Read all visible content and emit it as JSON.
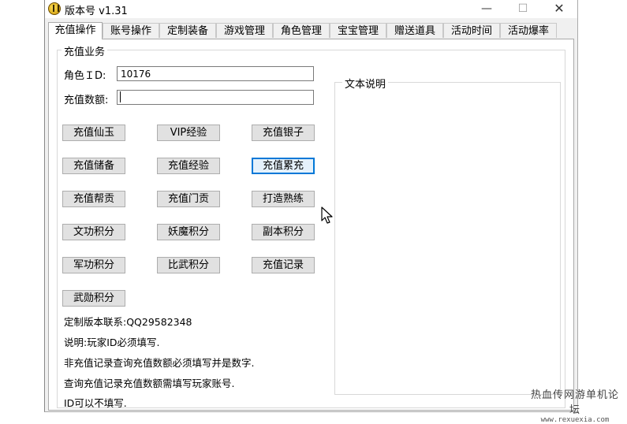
{
  "window": {
    "title": "版本号 v1.31",
    "minimize": "—",
    "maximize": "☐",
    "close": "✕"
  },
  "tabs": [
    "充值操作",
    "账号操作",
    "定制装备",
    "游戏管理",
    "角色管理",
    "宝宝管理",
    "赠送道具",
    "活动时间",
    "活动爆率"
  ],
  "group_title": "充值业务",
  "form": {
    "role_id_label": "角色ＩD:",
    "role_id_value": "10176",
    "amount_label": "充值数额:",
    "amount_value": ""
  },
  "buttons": [
    [
      "充值仙玉",
      "VIP经验",
      "充值银子"
    ],
    [
      "充值储备",
      "充值经验",
      "充值累充"
    ],
    [
      "充值帮贡",
      "充值门贡",
      "打造熟练"
    ],
    [
      "文功积分",
      "妖魔积分",
      "副本积分"
    ],
    [
      "军功积分",
      "比武积分",
      "充值记录"
    ],
    [
      "武勋积分"
    ]
  ],
  "focused_button": "充值累充",
  "notes": [
    "定制版本联系:QQ29582348",
    "说明:玩家ID必须填写.",
    "非充值记录查询充值数额必须填写并是数字.",
    "查询充值记录充值数额需填写玩家账号.",
    "ID可以不填写."
  ],
  "text_panel_title": "文本说明",
  "watermark": {
    "line1": "热血传网游单机论坛",
    "line2": "www.rexuexia.com"
  },
  "colors": {
    "focus_border": "#0078d7",
    "button_bg": "#e1e1e1",
    "window_bg": "#f0f0f0"
  }
}
